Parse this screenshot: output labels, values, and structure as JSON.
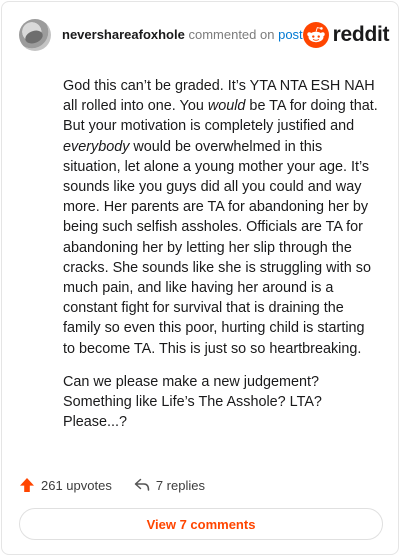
{
  "header": {
    "username": "nevershareafoxhole",
    "commented_on": "commented on",
    "post_link": "post",
    "brand": "reddit",
    "brand_color": "#ff4500",
    "link_color": "#0079d3"
  },
  "comment": {
    "p1_before_em1": "God this can’t be graded. It’s YTA NTA ESH NAH all rolled into one. You ",
    "em1": "would",
    "p1_after_em1": " be TA for doing that. But your motivation is completely justified and ",
    "em2": "everybody",
    "p1_after_em2": " would be overwhelmed in this situation, let alone a young mother your age. It’s sounds like you guys did all you could and way more. Her parents are TA for abandoning her by being such selfish assholes. Officials are TA for abandoning her by letting her slip through the cracks. She sounds like she is struggling with so much pain, and like having her around is a constant fight for survival that is draining the family so even this poor, hurting child is starting to become TA. This is just so so heartbreaking.",
    "p2": "Can we please make a new judgement? Something like Life’s The Asshole? LTA? Please...?"
  },
  "actions": {
    "upvotes": "261 upvotes",
    "replies": "7 replies",
    "upvote_icon": "upvote-arrow-icon",
    "reply_icon": "reply-arrow-icon"
  },
  "footer": {
    "view_button": "View 7 comments"
  }
}
